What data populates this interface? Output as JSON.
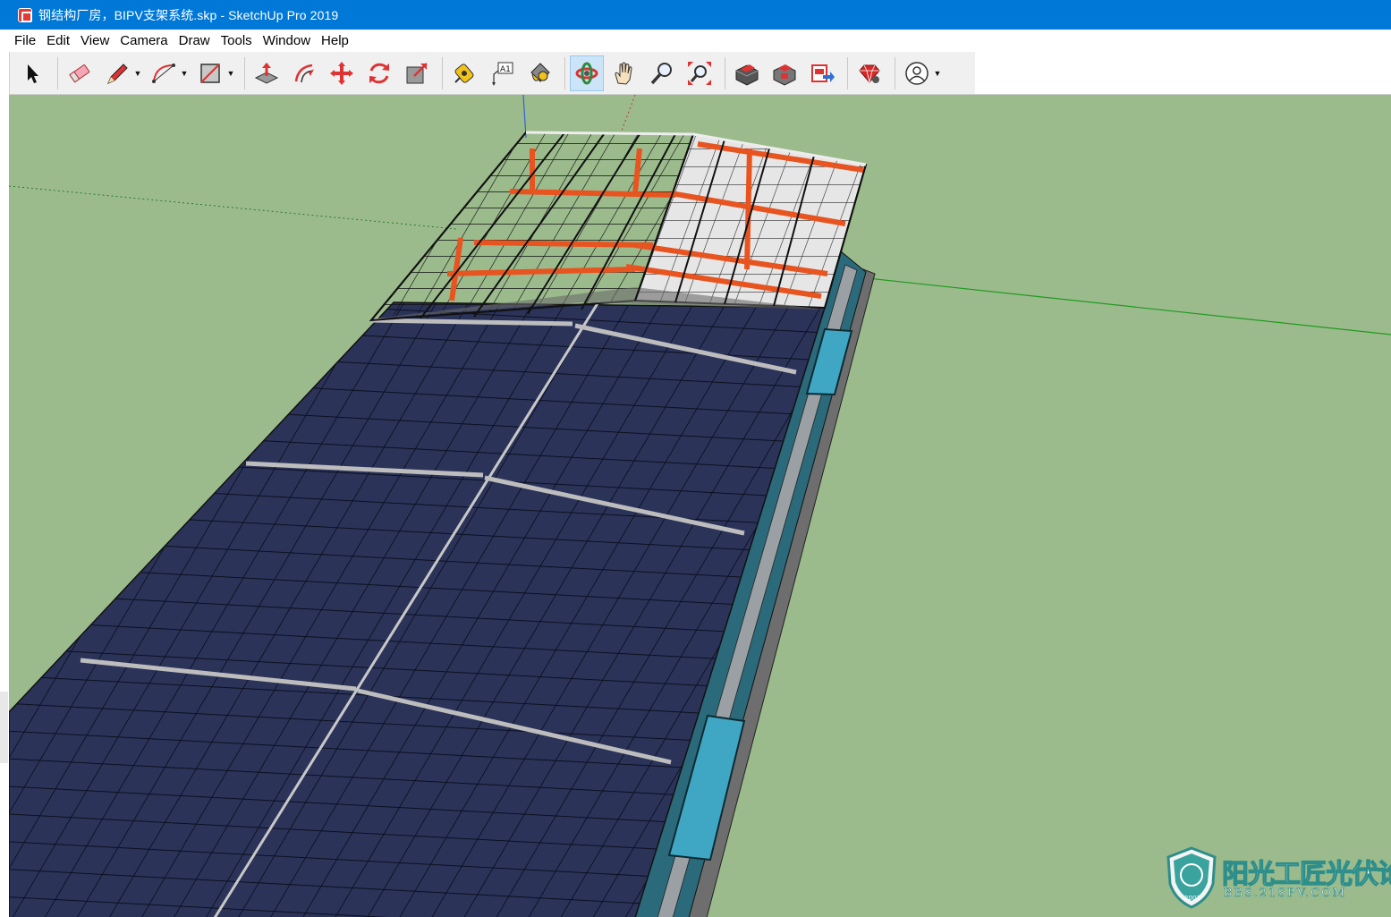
{
  "window": {
    "title": "钢结构厂房，BIPV支架系统.skp - SketchUp Pro 2019"
  },
  "menu": {
    "items": [
      "File",
      "Edit",
      "View",
      "Camera",
      "Draw",
      "Tools",
      "Window",
      "Help"
    ]
  },
  "toolbar": {
    "tools": [
      {
        "name": "select-icon"
      },
      {
        "name": "eraser-icon"
      },
      {
        "name": "pencil-line-icon"
      },
      {
        "name": "arc-icon"
      },
      {
        "name": "rectangle-shape-icon"
      },
      {
        "name": "push-pull-icon"
      },
      {
        "name": "offset-icon"
      },
      {
        "name": "move-icon"
      },
      {
        "name": "rotate-icon"
      },
      {
        "name": "scale-icon"
      },
      {
        "name": "tape-measure-icon"
      },
      {
        "name": "text-label-icon"
      },
      {
        "name": "paint-bucket-icon"
      },
      {
        "name": "orbit-icon",
        "active": true
      },
      {
        "name": "pan-icon"
      },
      {
        "name": "zoom-icon"
      },
      {
        "name": "zoom-extents-icon"
      },
      {
        "name": "3d-warehouse-icon"
      },
      {
        "name": "extension-warehouse-icon"
      },
      {
        "name": "send-to-layout-icon"
      },
      {
        "name": "extension-manager-icon"
      },
      {
        "name": "account-icon"
      }
    ],
    "text_tool_label": "A1"
  },
  "colors": {
    "titlebar": "#0078d7",
    "ground": "#9cbb8d",
    "panel": "#2a3255",
    "steel_red": "#e8541f",
    "glass_cyan": "#3fa6c3"
  },
  "watermark": {
    "text": "阳光工匠光伏论坛",
    "subtext": "BBS.21SPV.COM",
    "year": "2007"
  }
}
